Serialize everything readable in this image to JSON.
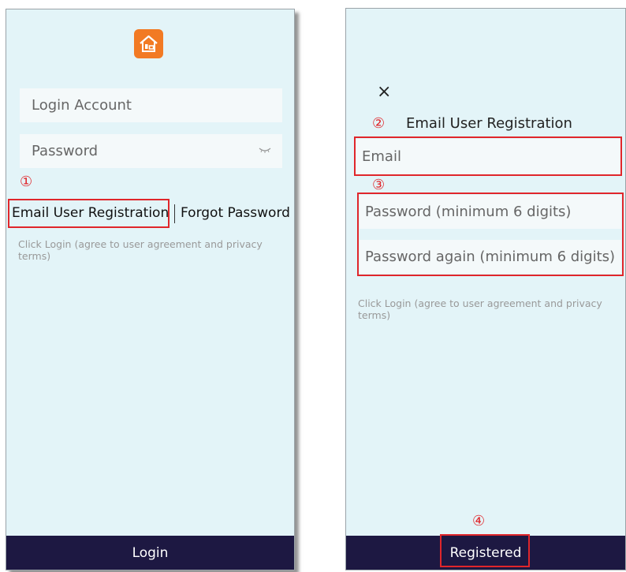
{
  "login_screen": {
    "logo": "house-logo-icon",
    "account_placeholder": "Login Account",
    "password_placeholder": "Password",
    "password_toggle_icon": "eye-closed-icon",
    "step_marker": "①",
    "register_link": "Email User Registration",
    "forgot_link": "Forgot Password",
    "terms": "Click Login (agree to user agreement and privacy terms)",
    "login_button": "Login"
  },
  "registration_screen": {
    "close_icon": "×",
    "step_marker_title": "②",
    "title": "Email User Registration",
    "email_placeholder": "Email",
    "step_marker_password": "③",
    "password_placeholder": "Password (minimum 6 digits)",
    "password_again_placeholder": "Password again (minimum 6 digits)",
    "terms": "Click Login (agree to user agreement and privacy terms)",
    "step_marker_submit": "④",
    "submit_button": "Registered"
  },
  "colors": {
    "screen_background": "#e3f4f8",
    "field_background": "#f4f9fa",
    "footer_background": "#1d1842",
    "brand_orange": "#f27a24",
    "annotation_red": "#e0262b"
  }
}
